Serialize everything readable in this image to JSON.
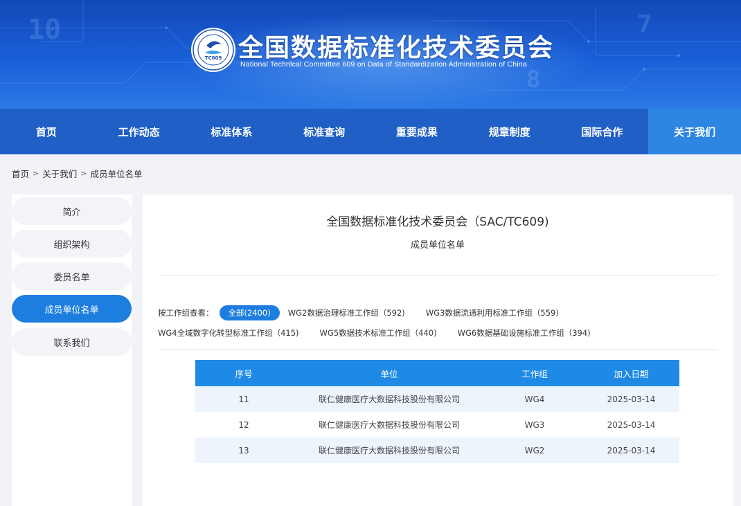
{
  "header": {
    "title": "全国数据标准化技术委员会",
    "subtitle": "National Technical Committee 609 on Data of Standardization Administration of China",
    "logo_text": "TC609"
  },
  "nav": [
    {
      "label": "首页"
    },
    {
      "label": "工作动态"
    },
    {
      "label": "标准体系"
    },
    {
      "label": "标准查询"
    },
    {
      "label": "重要成果"
    },
    {
      "label": "规章制度"
    },
    {
      "label": "国际合作"
    },
    {
      "label": "关于我们",
      "active": true
    }
  ],
  "breadcrumb": [
    "首页",
    "关于我们",
    "成员单位名单"
  ],
  "sidebar": [
    {
      "label": "简介"
    },
    {
      "label": "组织架构"
    },
    {
      "label": "委员名单"
    },
    {
      "label": "成员单位名单",
      "active": true
    },
    {
      "label": "联系我们"
    }
  ],
  "main": {
    "title": "全国数据标准化技术委员会（SAC/TC609)",
    "subtitle": "成员单位名单"
  },
  "filter": {
    "label": "按工作组查看：",
    "active": "全部(2400)",
    "row1": [
      "WG2数据治理标准工作组（592)",
      "WG3数据流通利用标准工作组（559)"
    ],
    "row2": [
      "WG4全域数字化转型标准工作组（415)",
      "WG5数据技术标准工作组（440)",
      "WG6数据基础设施标准工作组（394)"
    ]
  },
  "table": {
    "headers": [
      "序号",
      "单位",
      "工作组",
      "加入日期"
    ],
    "rows": [
      [
        "11",
        "联仁健康医疗大数据科技股份有限公司",
        "WG4",
        "2025-03-14"
      ],
      [
        "12",
        "联仁健康医疗大数据科技股份有限公司",
        "WG3",
        "2025-03-14"
      ],
      [
        "13",
        "联仁健康医疗大数据科技股份有限公司",
        "WG2",
        "2025-03-14"
      ]
    ]
  },
  "colors": {
    "banner": "#1a5fd8",
    "nav": "#1f5fc6",
    "nav_active": "#2e86e3",
    "accent": "#1e7ee0",
    "table_head": "#1e8ae6",
    "row_alt": "#edf4fc"
  }
}
